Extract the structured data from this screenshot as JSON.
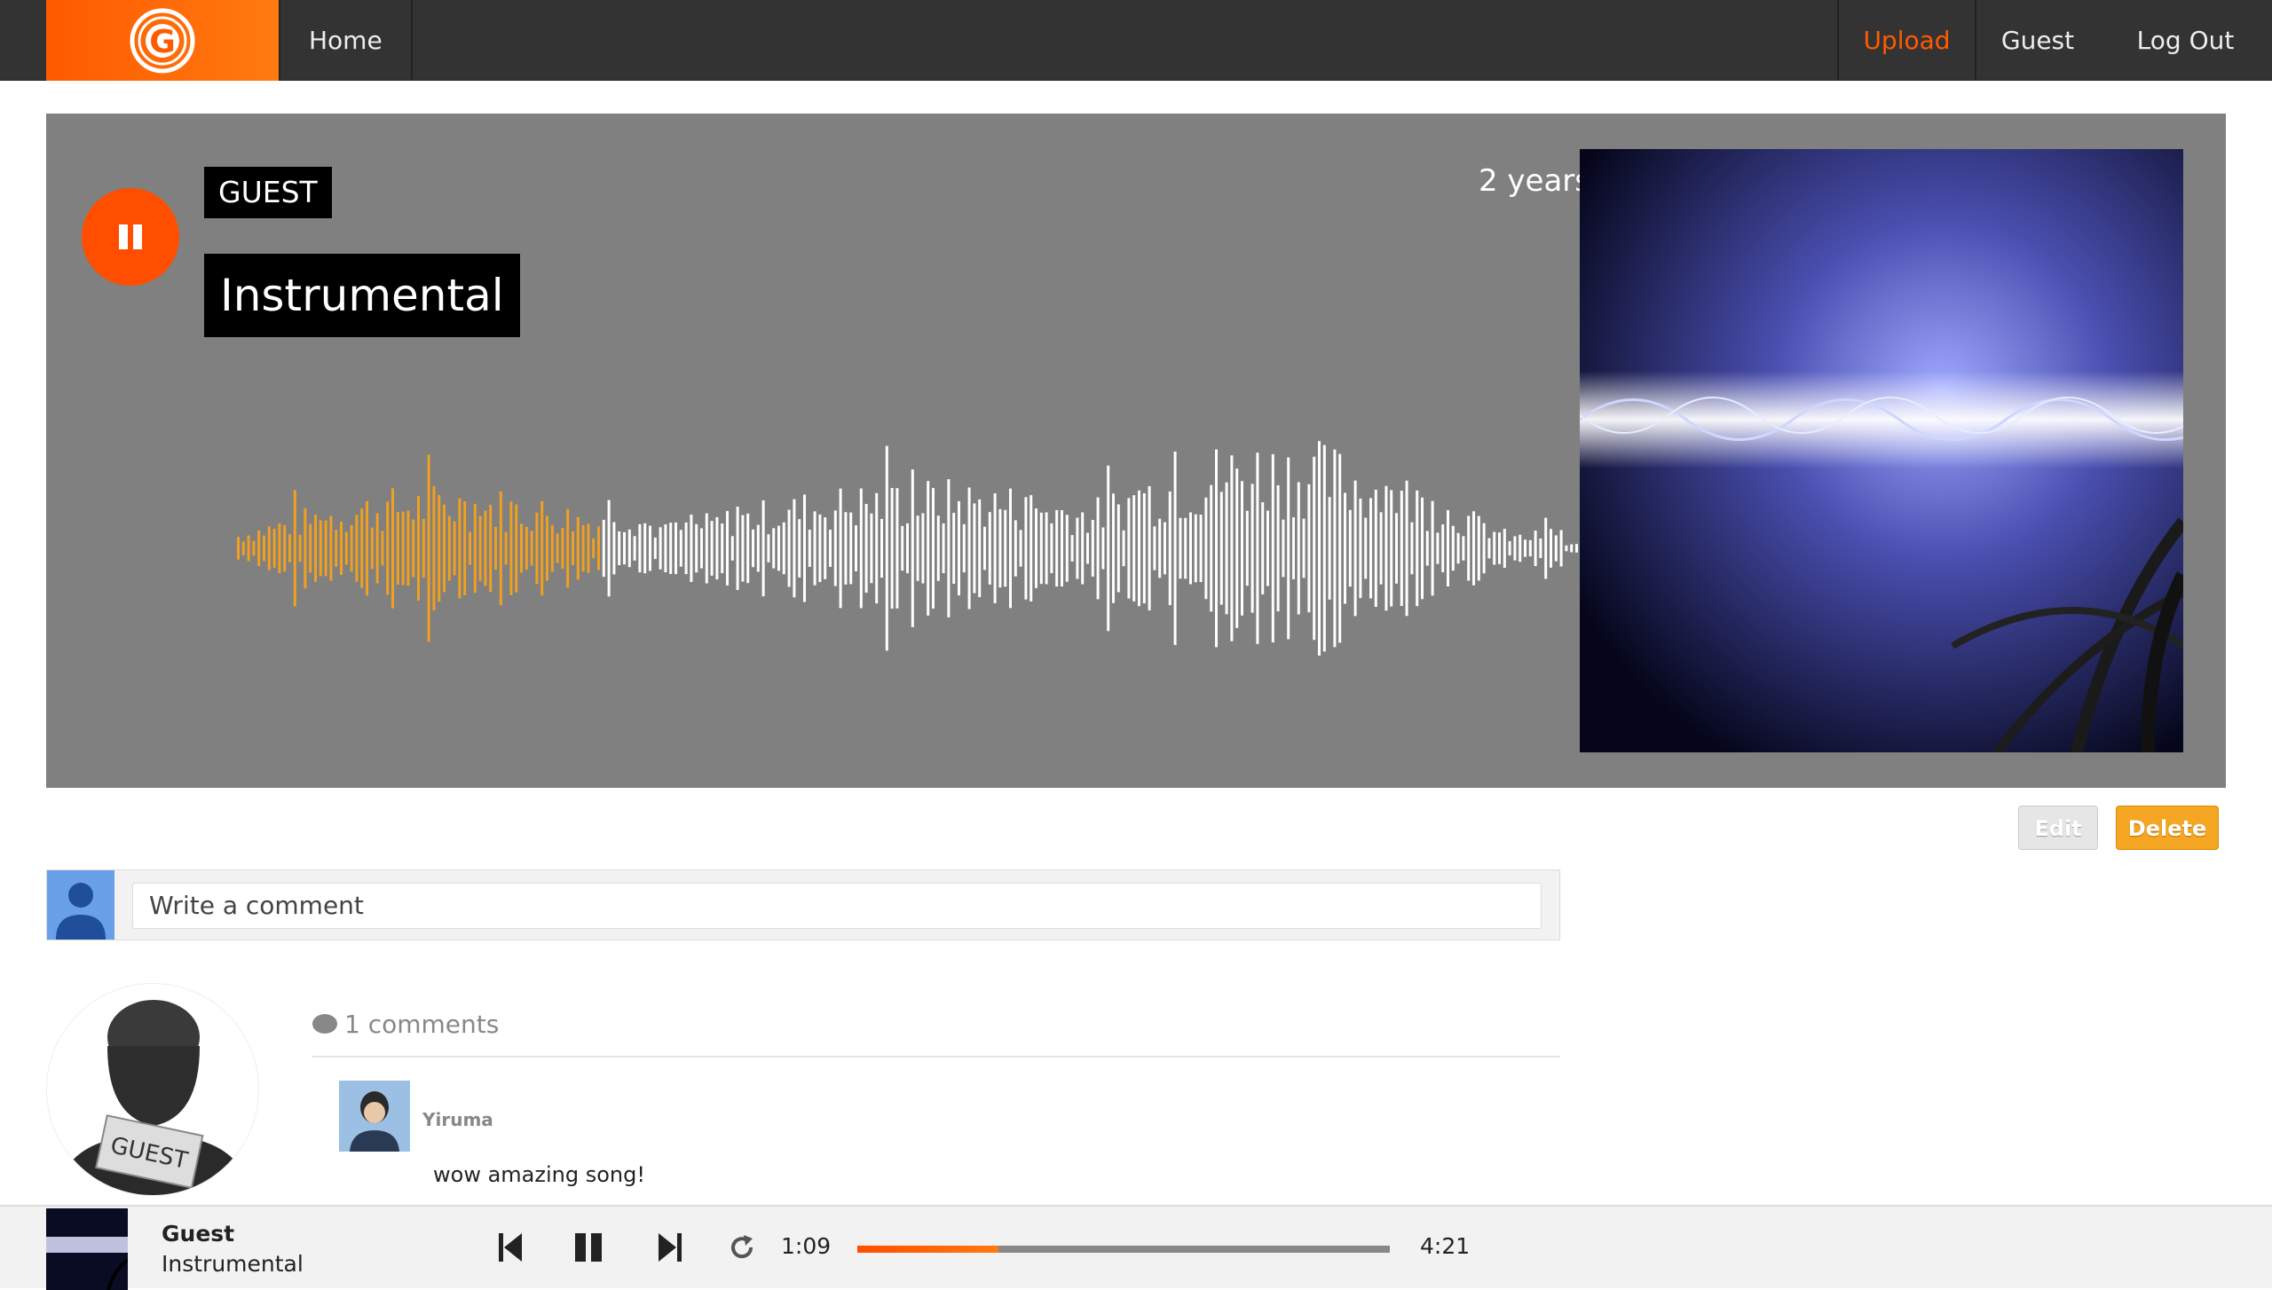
{
  "nav": {
    "home": "Home",
    "upload": "Upload",
    "guest": "Guest",
    "logout": "Log Out"
  },
  "track": {
    "artist": "GUEST",
    "title": "Instrumental",
    "age": "2 years",
    "progress": 0.265
  },
  "actions": {
    "edit": "Edit",
    "delete": "Delete"
  },
  "comment_input": {
    "placeholder": "Write a comment"
  },
  "profile": {
    "badge": "GUEST"
  },
  "comments": {
    "count_label": "1 comments",
    "items": [
      {
        "user": "Yiruma",
        "text": "wow amazing song!"
      }
    ]
  },
  "player": {
    "artist": "Guest",
    "title": "Instrumental",
    "current_time": "1:09",
    "duration": "4:21",
    "progress": 0.265
  },
  "colors": {
    "accent": "#ff5a00",
    "played_wave": "#f0a020",
    "unplayed_wave": "#ffffff",
    "hero_bg": "#808080",
    "nav_bg": "#333333",
    "delete_btn": "#f5a623"
  }
}
